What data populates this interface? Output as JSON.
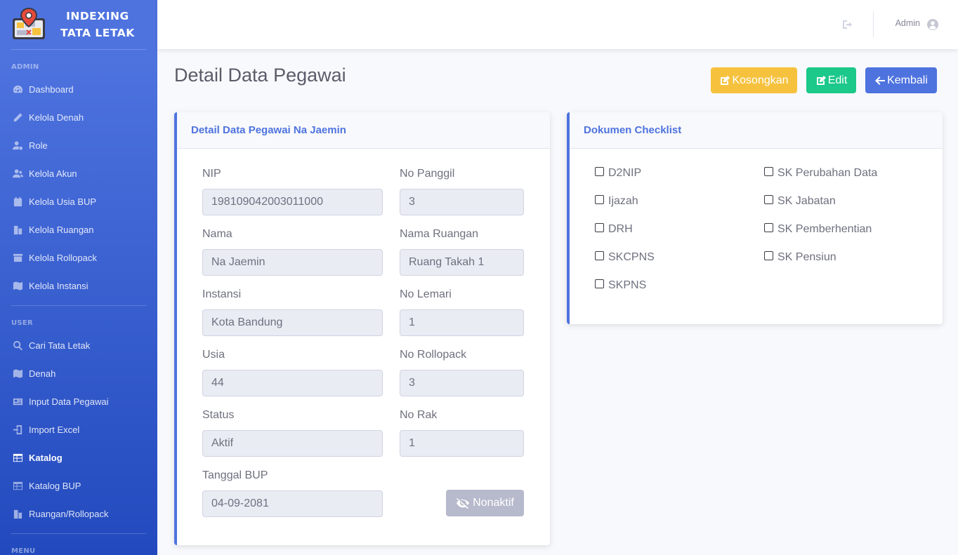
{
  "brand": {
    "line1": "INDEXING",
    "line2": "TATA LETAK"
  },
  "sidebar": {
    "heading_admin": "ADMIN",
    "heading_user": "USER",
    "heading_menu": "MENU",
    "admin_items": [
      {
        "label": "Dashboard",
        "icon": "dashboard-icon"
      },
      {
        "label": "Kelola Denah",
        "icon": "pencil-icon"
      },
      {
        "label": "Role",
        "icon": "user-cog-icon"
      },
      {
        "label": "Kelola Akun",
        "icon": "users-icon"
      },
      {
        "label": "Kelola Usia BUP",
        "icon": "calendar-icon"
      },
      {
        "label": "Kelola Ruangan",
        "icon": "building-icon"
      },
      {
        "label": "Kelola Rollopack",
        "icon": "archive-icon"
      },
      {
        "label": "Kelola Instansi",
        "icon": "map-icon"
      }
    ],
    "user_items": [
      {
        "label": "Cari Tata Letak",
        "icon": "search-icon"
      },
      {
        "label": "Denah",
        "icon": "map-icon"
      },
      {
        "label": "Input Data Pegawai",
        "icon": "id-card-icon"
      },
      {
        "label": "Import Excel",
        "icon": "import-icon"
      },
      {
        "label": "Katalog",
        "icon": "table-icon",
        "active": true
      },
      {
        "label": "Katalog BUP",
        "icon": "table-icon"
      },
      {
        "label": "Ruangan/Rollopack",
        "icon": "building-icon"
      }
    ]
  },
  "topbar": {
    "user_name": "Admin"
  },
  "page": {
    "title": "Detail Data Pegawai",
    "buttons": {
      "kosongkan": "Kosongkan",
      "edit": "Edit",
      "kembali": "Kembali"
    }
  },
  "detail_card": {
    "title": "Detail Data Pegawai Na Jaemin",
    "fields": {
      "nip": {
        "label": "NIP",
        "value": "198109042003011000"
      },
      "no_panggil": {
        "label": "No Panggil",
        "value": "3"
      },
      "nama": {
        "label": "Nama",
        "value": "Na Jaemin"
      },
      "nama_ruangan": {
        "label": "Nama Ruangan",
        "value": "Ruang Takah 1"
      },
      "instansi": {
        "label": "Instansi",
        "value": "Kota Bandung"
      },
      "no_lemari": {
        "label": "No Lemari",
        "value": "1"
      },
      "usia": {
        "label": "Usia",
        "value": "44"
      },
      "no_rollopack": {
        "label": "No Rollopack",
        "value": "3"
      },
      "status": {
        "label": "Status",
        "value": "Aktif"
      },
      "no_rak": {
        "label": "No Rak",
        "value": "1"
      },
      "tanggal_bup": {
        "label": "Tanggal BUP",
        "value": "04-09-2081"
      }
    },
    "nonaktif_label": "Nonaktif"
  },
  "checklist_card": {
    "title": "Dokumen Checklist",
    "left": [
      "D2NIP",
      "Ijazah",
      "DRH",
      "SKCPNS",
      "SKPNS"
    ],
    "right": [
      "SK Perubahan Data",
      "SK Jabatan",
      "SK Pemberhentian",
      "SK Pensiun"
    ]
  },
  "colors": {
    "primary": "#4e73df",
    "warning": "#f6c23e",
    "success": "#1cc88a",
    "secondary": "#b7b9cc"
  }
}
